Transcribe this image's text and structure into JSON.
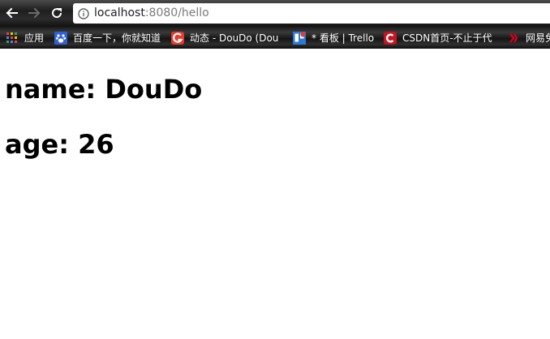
{
  "browser": {
    "address": {
      "host": "localhost",
      "rest": ":8080/hello"
    },
    "icons": {
      "back": "back-arrow-icon",
      "forward": "forward-arrow-icon",
      "reload": "reload-icon",
      "info": "info-icon"
    }
  },
  "bookmarks": [
    {
      "label": "应用",
      "icon": "apps-grid-icon"
    },
    {
      "label": "百度一下，你就知道",
      "icon": "baidu-paw-icon"
    },
    {
      "label": "动态 - DouDo (Dou",
      "icon": "g-logo-icon"
    },
    {
      "label": "* 看板 | Trello",
      "icon": "trello-icon"
    },
    {
      "label": "CSDN首页-不止于代",
      "icon": "csdn-icon"
    },
    {
      "label": "网易免",
      "icon": "netease-icon"
    }
  ],
  "page": {
    "name_line": "name: DouDo",
    "age_line": "age: 26"
  },
  "colors": {
    "toolbar_bg": "#1e1e1e",
    "page_bg": "#ffffff",
    "url_host": "#202124",
    "url_rest": "#7a7a7a",
    "text": "#000000",
    "douban_red": "#e8392c",
    "csdn_red": "#c7141e",
    "trello_blue": "#2d7ad6",
    "baidu_blue": "#2f62d8"
  }
}
